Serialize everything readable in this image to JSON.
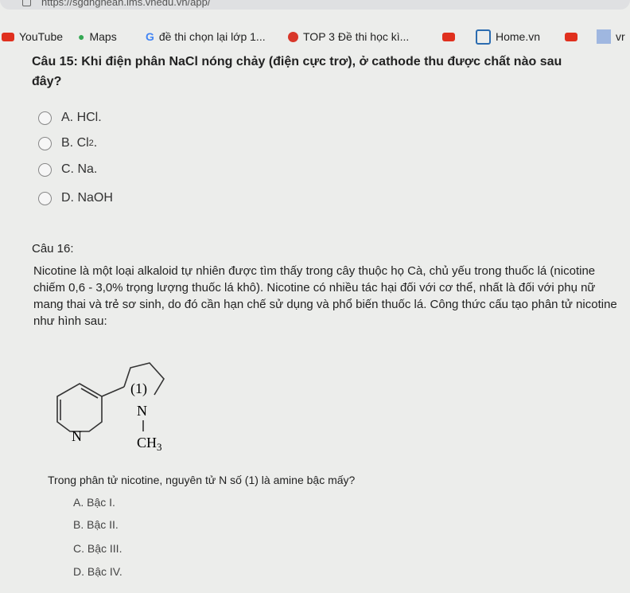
{
  "browser": {
    "url": "https://sgdnghean.lms.vnedu.vn/app/",
    "bookmarks": [
      {
        "label": "YouTube",
        "icon": "youtube-icon"
      },
      {
        "label": "Maps",
        "icon": "maps-pin-icon"
      },
      {
        "label": "đề thi chọn lại lớp 1...",
        "icon": "google-icon"
      },
      {
        "label": "TOP 3 Đề thi học kì...",
        "icon": "site-icon"
      },
      {
        "label": "",
        "icon": "youtube-icon"
      },
      {
        "label": "Home.vn",
        "icon": "home-vn-icon"
      },
      {
        "label": "",
        "icon": "youtube-icon"
      },
      {
        "label": "vr",
        "icon": "uneti-icon"
      }
    ]
  },
  "q15": {
    "title": "Câu 15: Khi điện phân NaCl nóng chảy (điện cực trơ), ở cathode thu được chất nào sau",
    "title2": "đây?",
    "options": [
      "A. HCl.",
      "B. Cl",
      "C. Na.",
      "D. NaOH"
    ],
    "sub": "2"
  },
  "q16": {
    "title": "Câu 16:",
    "para": "Nicotine là một loại alkaloid tự nhiên được tìm thấy trong cây thuộc họ Cà, chủ yếu trong thuốc lá (nicotine chiếm 0,6 - 3,0% trọng lượng thuốc lá khô). Nicotine có nhiều tác hại đối với cơ thể, nhất là đối với phụ nữ mang thai và trẻ sơ sinh, do đó cần hạn chế sử dụng và phổ biến thuốc lá. Công thức cấu tạo phân tử nicotine như hình sau:",
    "structure": {
      "label1": "(1)",
      "n1": "N",
      "n2": "N",
      "ch3": "CH",
      "sub3": "3"
    },
    "question": "Trong phân tử nicotine, nguyên tử N số (1) là amine bậc mấy?",
    "options": [
      "A. Bậc I.",
      "B. Bậc II.",
      "C. Bậc III.",
      "D. Bậc IV."
    ]
  }
}
